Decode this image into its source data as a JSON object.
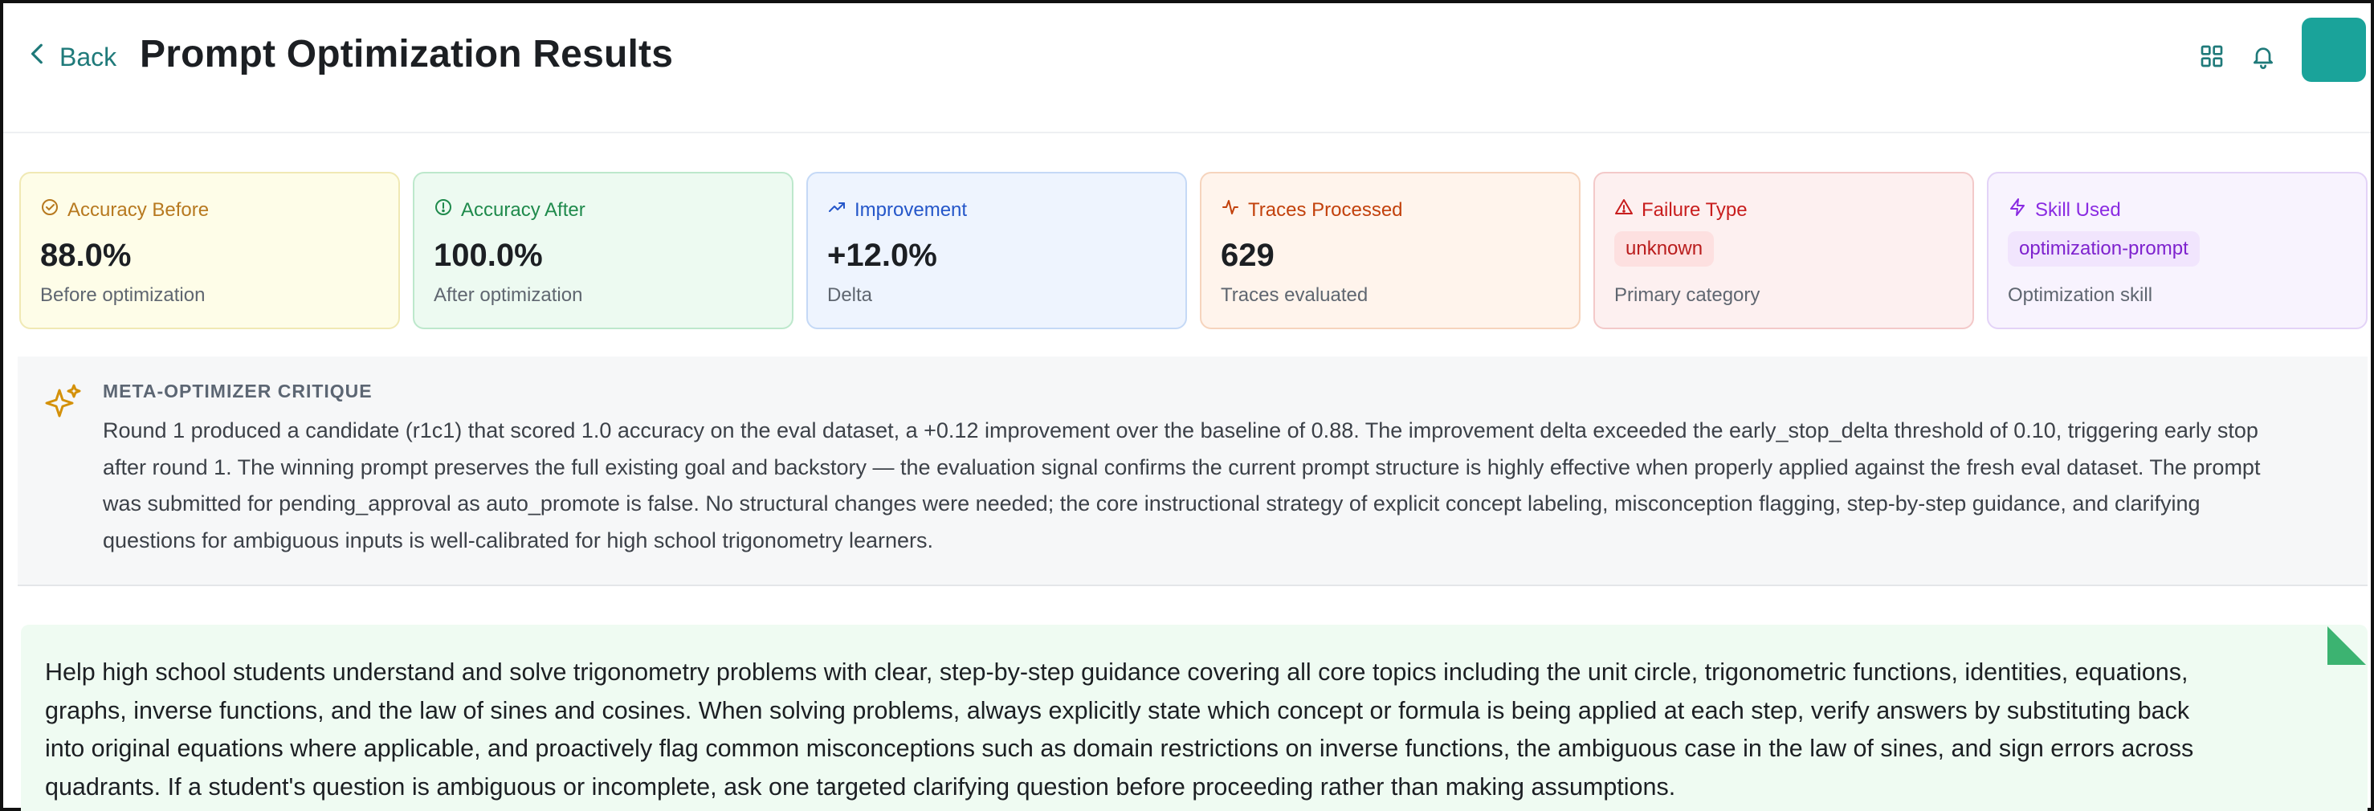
{
  "header": {
    "back_label": "Back",
    "title": "Prompt Optimization Results",
    "icons": [
      "grid-icon",
      "bell-icon"
    ],
    "avatar_color": "#1aa39a"
  },
  "cards": [
    {
      "label": "Accuracy Before",
      "value": "88.0%",
      "sub": "Before optimization",
      "icon": "check-circle-icon",
      "accent": "#b7791f",
      "bg": "#fefde8",
      "border": "#f0e9b4"
    },
    {
      "label": "Accuracy After",
      "value": "100.0%",
      "sub": "After optimization",
      "icon": "alert-circle-icon",
      "accent": "#1f8a4c",
      "bg": "#edfaf1",
      "border": "#bde8cc"
    },
    {
      "label": "Improvement",
      "value": "+12.0%",
      "sub": "Delta",
      "icon": "trending-up-icon",
      "accent": "#2456c9",
      "bg": "#eef4fe",
      "border": "#c5d9f6"
    },
    {
      "label": "Traces Processed",
      "value": "629",
      "sub": "Traces evaluated",
      "icon": "activity-icon",
      "accent": "#c2410c",
      "bg": "#fff4ec",
      "border": "#f6d4bd"
    },
    {
      "label": "Failure Type",
      "badge": "unknown",
      "sub": "Primary category",
      "icon": "warning-triangle-icon",
      "accent": "#c81e1e",
      "bg": "#fdf0f0",
      "border": "#f3c9c9",
      "badge_bg": "#fde0e0",
      "badge_color": "#b91c1c"
    },
    {
      "label": "Skill Used",
      "badge": "optimization-prompt",
      "sub": "Optimization skill",
      "icon": "lightning-icon",
      "accent": "#8a2be2",
      "bg": "#f8f3fe",
      "border": "#e3d3f7",
      "badge_bg": "#f1e5fd",
      "badge_color": "#7e22ce"
    }
  ],
  "critique": {
    "icon": "sparkles-icon",
    "title": "META-OPTIMIZER CRITIQUE",
    "lines": [
      "Round 1 produced a candidate (r1c1) that scored 1.0 accuracy on the eval dataset, a +0.12 improvement over the baseline of 0.88. The improvement delta exceeded the early_stop_delta threshold of 0.10, triggering early stop",
      "after round 1. The winning prompt preserves the full existing goal and backstory — the evaluation signal confirms the current prompt structure is highly effective when properly applied against the fresh eval dataset. The prompt",
      "was submitted for pending_approval as auto_promote is false. No structural changes were needed; the core instructional strategy of explicit concept labeling, misconception flagging, step-by-step guidance, and clarifying",
      "questions for ambiguous inputs is well-calibrated for high school trigonometry learners."
    ]
  },
  "prompt": {
    "lines": [
      "Help high school students understand and solve trigonometry problems with clear, step-by-step guidance covering all core topics including the unit circle, trigonometric functions, identities, equations,",
      "graphs, inverse functions, and the law of sines and cosines. When solving problems, always explicitly state which concept or formula is being applied at each step, verify answers by substituting back",
      "into original equations where applicable, and proactively flag common misconceptions such as domain restrictions on inverse functions, the ambiguous case in the law of sines, and sign errors across",
      "quadrants. If a student's question is ambiguous or incomplete, ask one targeted clarifying question before proceeding rather than making assumptions."
    ],
    "accent": "#3cb371"
  }
}
